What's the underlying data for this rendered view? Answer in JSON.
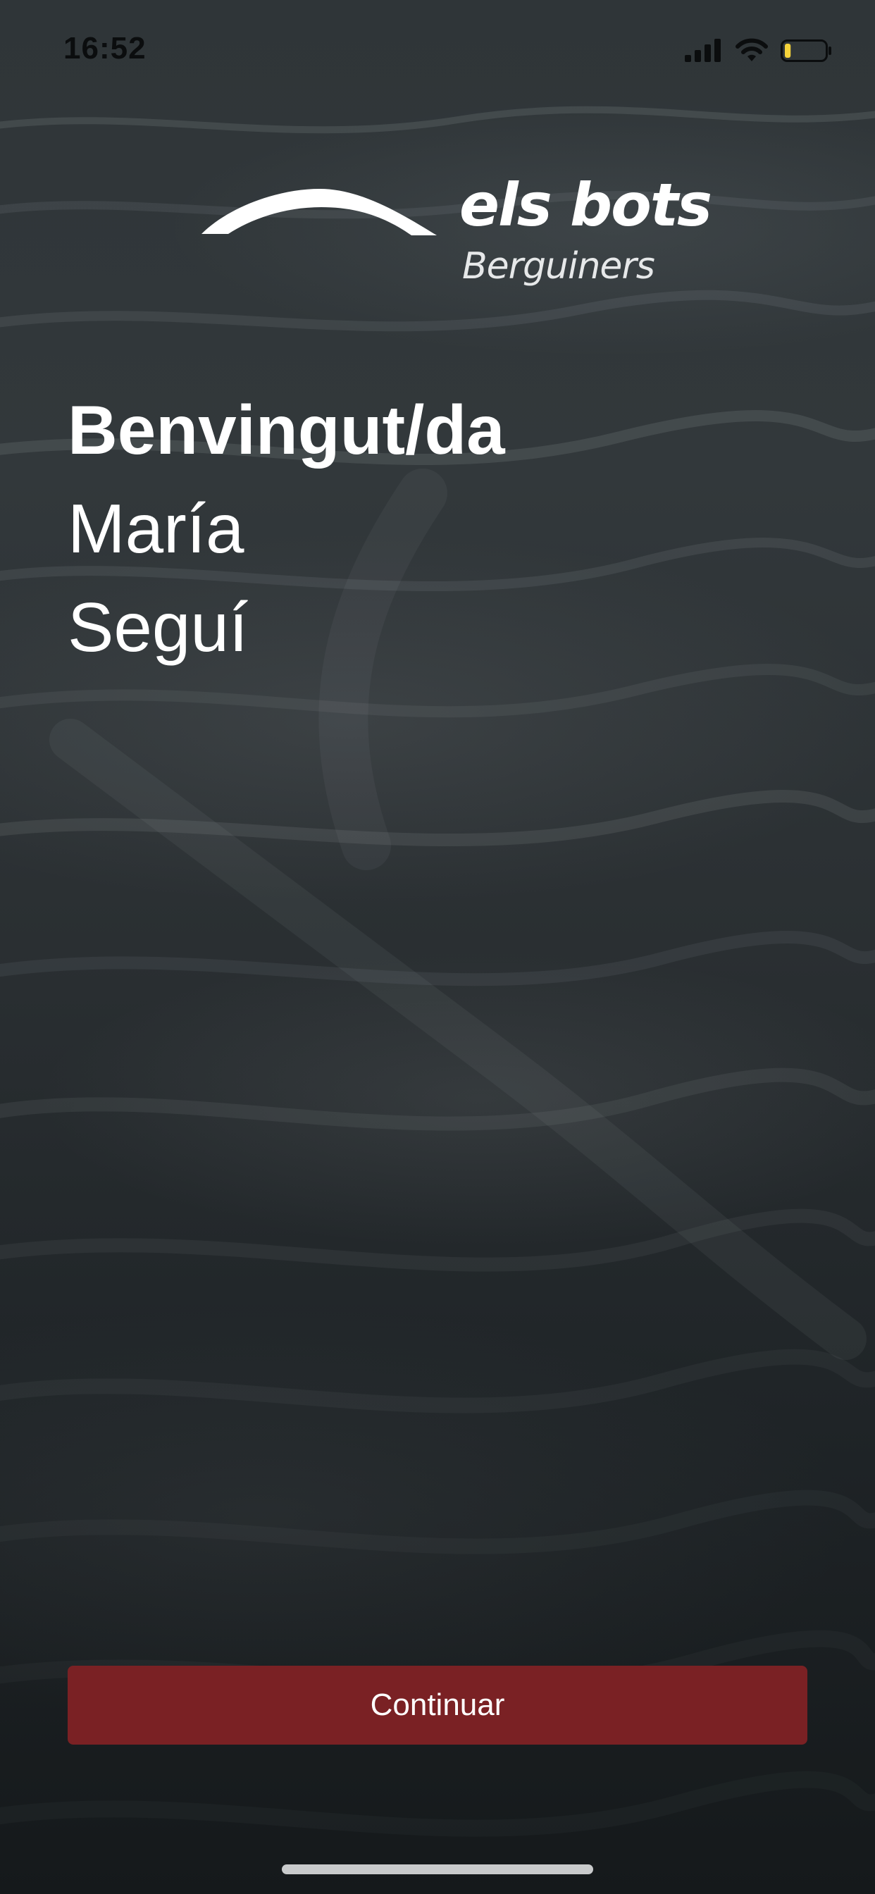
{
  "status_bar": {
    "time": "16:52",
    "icons": [
      "signal-icon",
      "wifi-icon",
      "battery-icon"
    ],
    "battery_level": 0.15,
    "battery_color": "#f5d33a"
  },
  "logo": {
    "name": "els bots",
    "subtitle": "Berguiners"
  },
  "welcome": {
    "title": "Benvingut/da",
    "first_name": "María",
    "last_name": "Seguí"
  },
  "actions": {
    "continue_label": "Continuar",
    "continue_color": "#7a2124"
  }
}
